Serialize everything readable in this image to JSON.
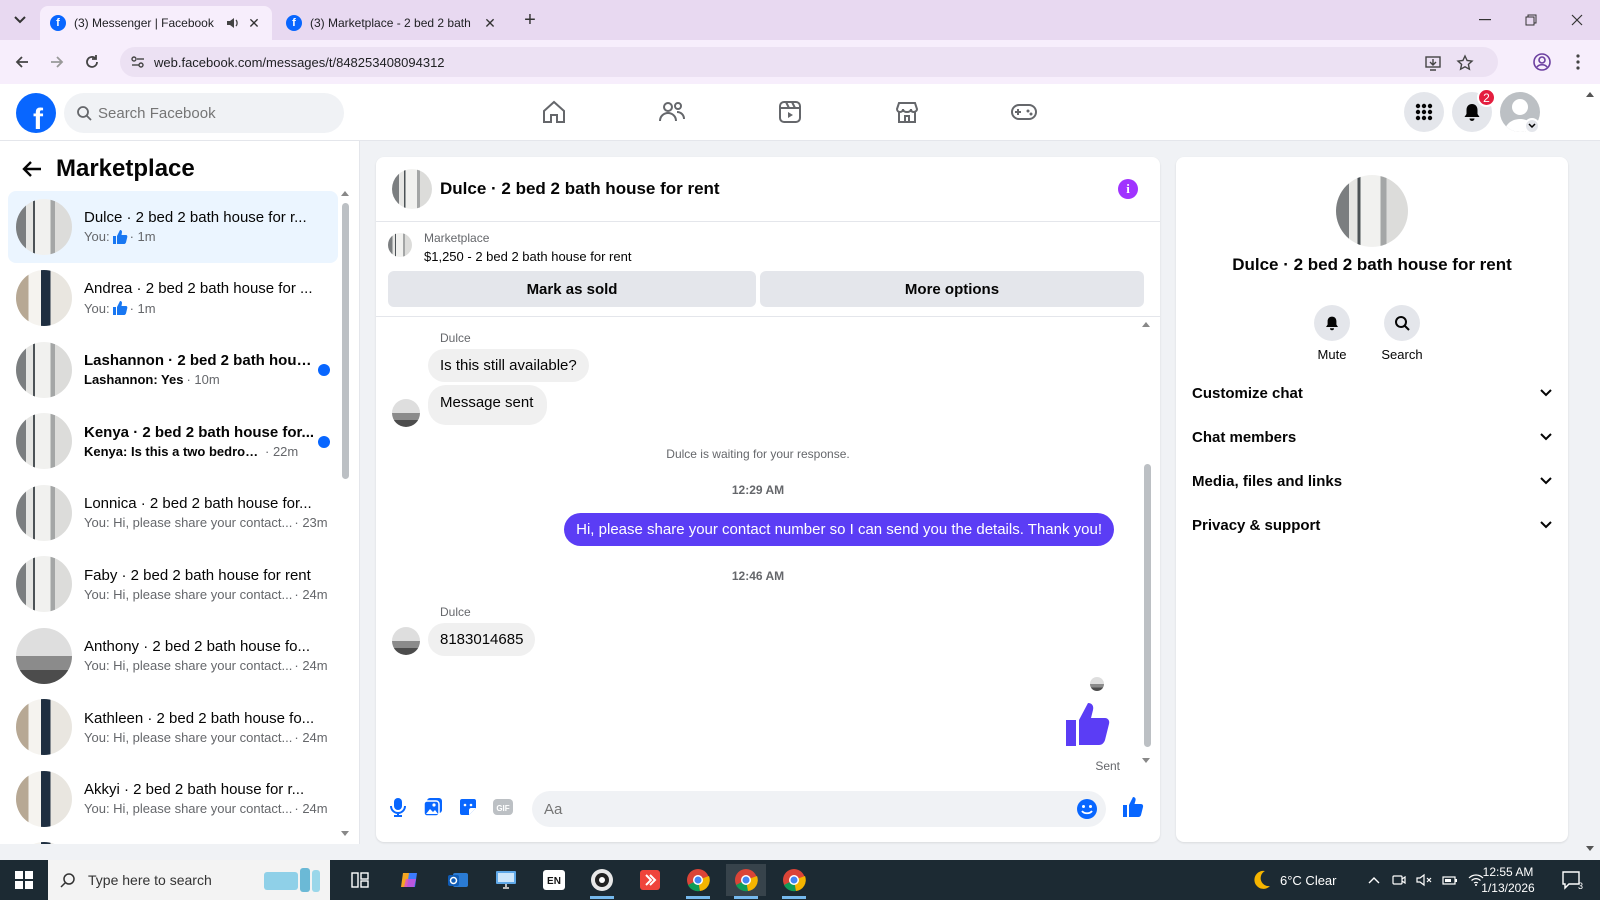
{
  "browser": {
    "tabs": [
      {
        "title": "(3) Messenger | Facebook",
        "active": true
      },
      {
        "title": "(3) Marketplace - 2 bed 2 bath",
        "active": false
      }
    ],
    "url": "web.facebook.com/messages/t/848253408094312"
  },
  "fb_header": {
    "search_placeholder": "Search Facebook",
    "notifications_count": "2",
    "nav_icons": [
      "home-icon",
      "friends-icon",
      "video-icon",
      "marketplace-icon",
      "gaming-icon"
    ]
  },
  "left_panel": {
    "title": "Marketplace",
    "conversations": [
      {
        "name": "Dulce · 2 bed 2 bath house for r...",
        "preview": "You:",
        "time": "· 1m",
        "liked": true,
        "unread": false,
        "active": true
      },
      {
        "name": "Andrea · 2 bed 2 bath house for ...",
        "preview": "You:",
        "time": "· 1m",
        "liked": true,
        "unread": false,
        "active": false
      },
      {
        "name": "Lashannon · 2 bed 2 bath hous...",
        "preview": "Lashannon: Yes",
        "time": "· 10m",
        "liked": false,
        "unread": true,
        "active": false
      },
      {
        "name": "Kenya · 2 bed 2 bath house for...",
        "preview": "Kenya: Is this a two bedroom ...",
        "time": "· 22m",
        "liked": false,
        "unread": true,
        "active": false
      },
      {
        "name": "Lonnica · 2 bed 2 bath house for...",
        "preview": "You: Hi, please share your contact...",
        "time": "· 23m",
        "liked": false,
        "unread": false,
        "active": false
      },
      {
        "name": "Faby · 2 bed 2 bath house for rent",
        "preview": "You: Hi, please share your contact...",
        "time": "· 24m",
        "liked": false,
        "unread": false,
        "active": false
      },
      {
        "name": "Anthony · 2 bed 2 bath house fo...",
        "preview": "You: Hi, please share your contact...",
        "time": "· 24m",
        "liked": false,
        "unread": false,
        "active": false
      },
      {
        "name": "Kathleen · 2 bed 2 bath house fo...",
        "preview": "You: Hi, please share your contact...",
        "time": "· 24m",
        "liked": false,
        "unread": false,
        "active": false
      },
      {
        "name": "Akkyi · 2 bed 2 bath house for r...",
        "preview": "You: Hi, please share your contact...",
        "time": "· 24m",
        "liked": false,
        "unread": false,
        "active": false
      }
    ]
  },
  "chat": {
    "title": "Dulce · 2 bed 2 bath house for rent",
    "marketplace_label": "Marketplace",
    "listing": "$1,250 - 2 bed 2 bath house for rent",
    "mark_sold_label": "Mark as sold",
    "more_options_label": "More options",
    "messages": {
      "sender1": "Dulce",
      "msg1": "Is this still available?",
      "msg2": "Message sent",
      "waiting": "Dulce is waiting for your response.",
      "time1": "12:29 AM",
      "out1": "Hi, please share your contact number so I can send you the details. Thank you!",
      "time2": "12:46 AM",
      "sender2": "Dulce",
      "msg3": "8183014685",
      "sent_label": "Sent"
    },
    "composer_placeholder": "Aa"
  },
  "info_panel": {
    "name": "Dulce · 2 bed 2 bath house for rent",
    "mute_label": "Mute",
    "search_label": "Search",
    "sections": [
      "Customize chat",
      "Chat members",
      "Media, files and links",
      "Privacy & support"
    ]
  },
  "taskbar": {
    "search_placeholder": "Type here to search",
    "weather": "6°C  Clear",
    "time": "12:55 AM",
    "date": "1/13/2026",
    "notif_count": "3",
    "lang": "EN"
  },
  "colors": {
    "fb_blue": "#0866ff",
    "outgoing_bubble": "#5b3df5",
    "like_thumb": "#5b3df5",
    "info_purple": "#a033ff"
  }
}
